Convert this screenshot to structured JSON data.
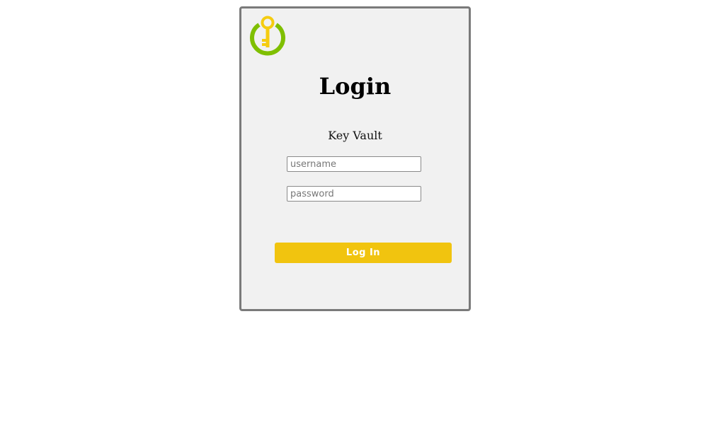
{
  "login_card": {
    "logo_icon": "key-power-icon",
    "title": "Login",
    "subtitle": "Key Vault",
    "username": {
      "placeholder": "username",
      "value": ""
    },
    "password": {
      "placeholder": "password",
      "value": ""
    },
    "submit_label": "Log In"
  },
  "colors": {
    "card_background": "#f1f1f1",
    "card_border": "#7a7a7a",
    "button": "#f1c40f",
    "button_text": "#ffffff",
    "logo_ring": "#7fbf00",
    "logo_key": "#f5cc10"
  }
}
